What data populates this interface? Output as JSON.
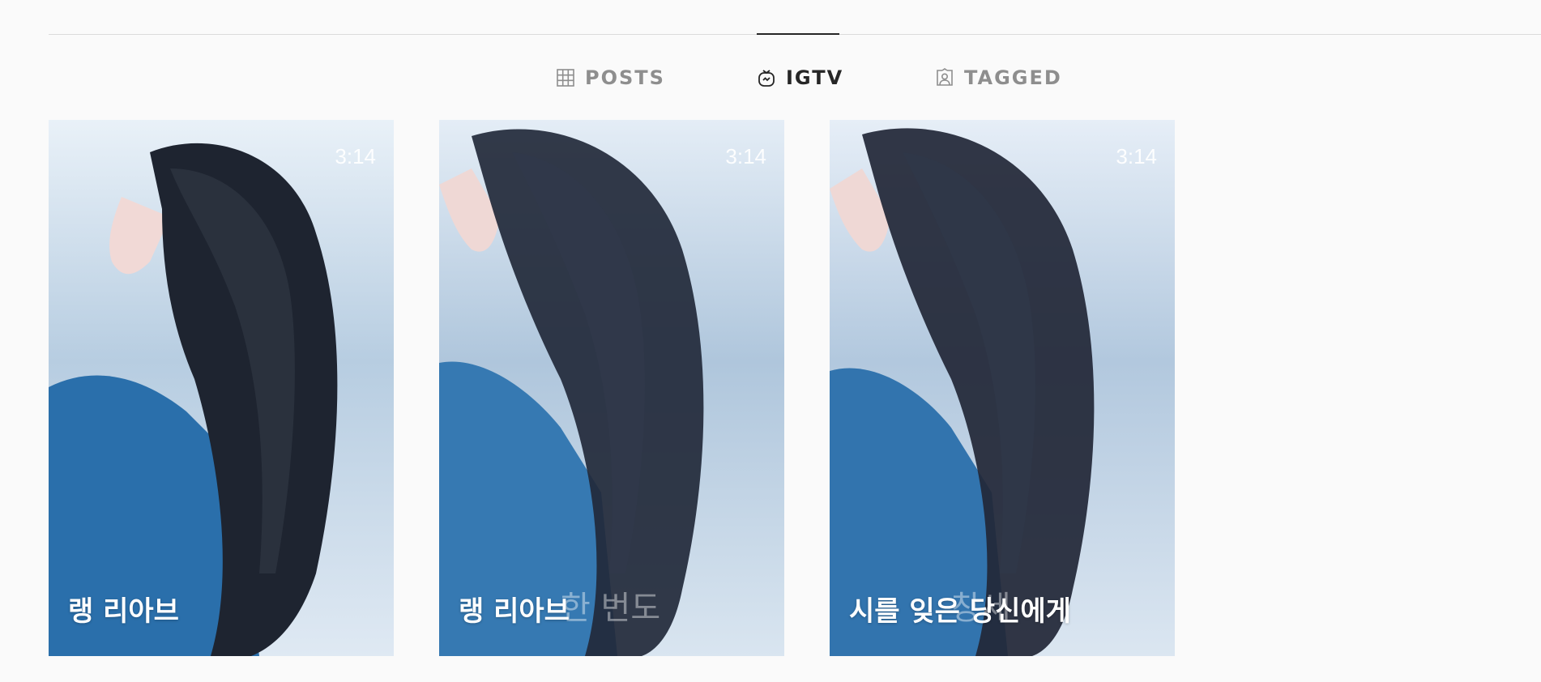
{
  "tabs": [
    {
      "label": "POSTS",
      "icon": "grid-icon",
      "active": false
    },
    {
      "label": "IGTV",
      "icon": "igtv-icon",
      "active": true
    },
    {
      "label": "TAGGED",
      "icon": "tagged-icon",
      "active": false
    }
  ],
  "videos": [
    {
      "title": "랭 리아브",
      "ghost_text": "",
      "duration": "3:14"
    },
    {
      "title": "랭 리아브",
      "ghost_text": "한 번도",
      "duration": "3:14"
    },
    {
      "title": "시를 잊은 당신에게",
      "ghost_text": "창세",
      "duration": "3:14"
    }
  ],
  "colors": {
    "background": "#fafafa",
    "active_tab": "#262626",
    "inactive_tab": "#8e8e8e",
    "divider": "#dbdbdb",
    "coat_blue": "#2a6fab",
    "hair_dark": "#1e2430"
  }
}
